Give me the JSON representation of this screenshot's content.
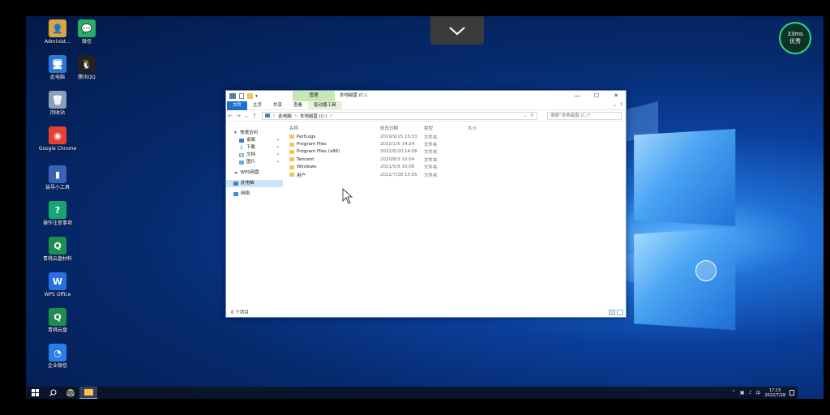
{
  "desktop": {
    "icons": [
      {
        "label": "Administ...",
        "glyph": "👤",
        "color": "#d9a441"
      },
      {
        "label": "微信",
        "glyph": "💬",
        "color": "#2aae67"
      },
      {
        "label": "此电脑",
        "glyph": "🖥",
        "color": "#2b79d6"
      },
      {
        "label": "腾讯QQ",
        "glyph": "🐧",
        "color": "#222222"
      },
      {
        "label": "回收站",
        "glyph": "🗑",
        "color": "#8aa0b8"
      },
      {
        "label": "Google Chrome",
        "glyph": "◉",
        "color": "#e44133"
      },
      {
        "label": "装导小工具",
        "glyph": "▮",
        "color": "#3a63b8"
      },
      {
        "label": "操作注意事项",
        "glyph": "?",
        "color": "#17a673"
      },
      {
        "label": "青桃云盘材料",
        "glyph": "Q",
        "color": "#1e8e4f"
      },
      {
        "label": "WPS Office",
        "glyph": "W",
        "color": "#2a6fe0"
      },
      {
        "label": "青桃云盘",
        "glyph": "Q",
        "color": "#1e8e4f"
      },
      {
        "label": "企业微信",
        "glyph": "◔",
        "color": "#2b7de9"
      }
    ]
  },
  "ping": {
    "value": "33ms",
    "status": "优秀"
  },
  "explorer": {
    "manage_tab": "管理",
    "title": "本地磁盘 (C:)",
    "ribbon_tabs": [
      "文件",
      "主页",
      "共享",
      "查看",
      "驱动器工具"
    ],
    "address": {
      "segments": [
        "此电脑",
        "本地磁盘 (C:)"
      ]
    },
    "search_placeholder": "搜索\"本地磁盘 (C:)\"",
    "nav": {
      "quick_access": "快速访问",
      "items": [
        "桌面",
        "下载",
        "文档",
        "图片"
      ],
      "wps": "WPS网盘",
      "this_pc": "此电脑",
      "network": "网络"
    },
    "columns": [
      "名称",
      "修改日期",
      "类型",
      "大小"
    ],
    "files": [
      {
        "name": "PerfLogs",
        "date": "2019/9/15 15:33",
        "type": "文件夹"
      },
      {
        "name": "Program Files",
        "date": "2022/1/6 14:24",
        "type": "文件夹"
      },
      {
        "name": "Program Files (x86)",
        "date": "2022/6/20 14:08",
        "type": "文件夹"
      },
      {
        "name": "Tencent",
        "date": "2020/8/3 10:04",
        "type": "文件夹"
      },
      {
        "name": "Windows",
        "date": "2021/5/8 10:08",
        "type": "文件夹"
      },
      {
        "name": "用户",
        "date": "2022/7/28 15:05",
        "type": "文件夹"
      }
    ],
    "status": "6 个项目"
  },
  "taskbar": {
    "clock_time": "17:15",
    "clock_date": "2022/7/28",
    "tray_icons": [
      "^",
      "▣",
      "♪",
      "中"
    ]
  }
}
